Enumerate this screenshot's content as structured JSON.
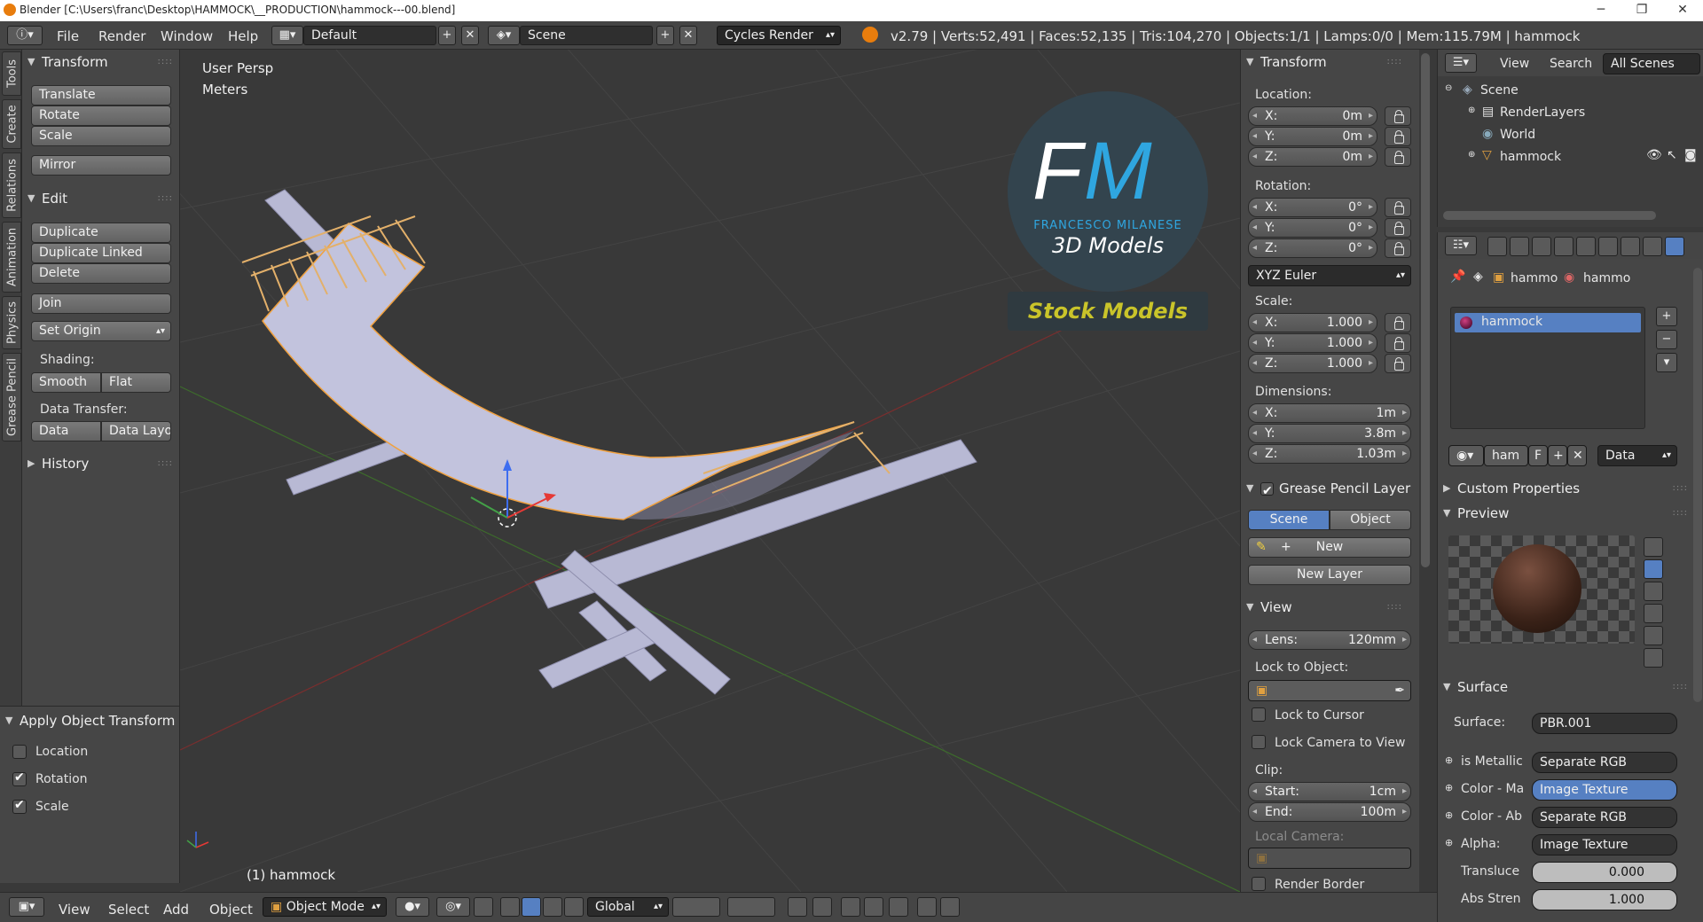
{
  "window": {
    "title": "Blender [C:\\Users\\franc\\Desktop\\HAMMOCK\\__PRODUCTION\\hammock---00.blend]",
    "minimize": "─",
    "maximize": "❐",
    "close": "✕"
  },
  "topbar": {
    "menus": [
      "File",
      "Render",
      "Window",
      "Help"
    ],
    "layout": "Default",
    "scene": "Scene",
    "engine": "Cycles Render",
    "stats": "v2.79 | Verts:52,491 | Faces:52,135 | Tris:104,270 | Objects:1/1 | Lamps:0/0 | Mem:115.79M | hammock"
  },
  "lefttabs": [
    "Tools",
    "Create",
    "Relations",
    "Animation",
    "Physics",
    "Grease Pencil"
  ],
  "toolshelf": {
    "transform": {
      "title": "Transform",
      "buttons": [
        "Translate",
        "Rotate",
        "Scale",
        "Mirror"
      ]
    },
    "edit": {
      "title": "Edit",
      "buttons": [
        "Duplicate",
        "Duplicate Linked",
        "Delete",
        "Join",
        "Set Origin"
      ]
    },
    "shading": {
      "label": "Shading:",
      "smooth": "Smooth",
      "flat": "Flat"
    },
    "datatransfer": {
      "label": "Data Transfer:",
      "data": "Data",
      "datalayo": "Data Layo"
    },
    "history": "History"
  },
  "operator": {
    "title": "Apply Object Transform",
    "options": [
      {
        "label": "Location",
        "checked": false
      },
      {
        "label": "Rotation",
        "checked": true
      },
      {
        "label": "Scale",
        "checked": true
      }
    ]
  },
  "viewport": {
    "view_name": "User Persp",
    "units": "Meters",
    "object_label": "(1) hammock",
    "watermark": {
      "initials_f": "F",
      "initials_m": "M",
      "name": "FRANCESCO MILANESE",
      "sub": "3D Models",
      "badge": "Stock Models"
    }
  },
  "npanel": {
    "transform": "Transform",
    "location_label": "Location:",
    "location": [
      {
        "k": "X:",
        "v": "0m"
      },
      {
        "k": "Y:",
        "v": "0m"
      },
      {
        "k": "Z:",
        "v": "0m"
      }
    ],
    "rotation_label": "Rotation:",
    "rotation": [
      {
        "k": "X:",
        "v": "0°"
      },
      {
        "k": "Y:",
        "v": "0°"
      },
      {
        "k": "Z:",
        "v": "0°"
      }
    ],
    "rotation_mode": "XYZ Euler",
    "scale_label": "Scale:",
    "scale": [
      {
        "k": "X:",
        "v": "1.000"
      },
      {
        "k": "Y:",
        "v": "1.000"
      },
      {
        "k": "Z:",
        "v": "1.000"
      }
    ],
    "dimensions_label": "Dimensions:",
    "dimensions": [
      {
        "k": "X:",
        "v": "1m"
      },
      {
        "k": "Y:",
        "v": "3.8m"
      },
      {
        "k": "Z:",
        "v": "1.03m"
      }
    ],
    "grease": {
      "title": "Grease Pencil Layer",
      "scene": "Scene",
      "object": "Object",
      "new": "New",
      "new_layer": "New Layer"
    },
    "view": {
      "title": "View",
      "lens_k": "Lens:",
      "lens_v": "120mm",
      "lock_obj": "Lock to Object:",
      "lock_cursor": "Lock to Cursor",
      "lock_camera": "Lock Camera to View",
      "clip": "Clip:",
      "start_k": "Start:",
      "start_v": "1cm",
      "end_k": "End:",
      "end_v": "100m",
      "local_camera": "Local Camera:",
      "render_border": "Render Border"
    }
  },
  "outliner": {
    "view": "View",
    "search": "Search",
    "filter": "All Scenes",
    "items": [
      "Scene",
      "RenderLayers",
      "World",
      "hammock"
    ]
  },
  "props": {
    "breadcrumb": [
      "hammo",
      "hammo"
    ],
    "material": "hammock",
    "slot_name": "ham",
    "slot_f": "F",
    "slot_data": "Data",
    "custom_props": "Custom Properties",
    "preview": "Preview",
    "surface": "Surface",
    "rows": [
      {
        "k": "Surface:",
        "v": "PBR.001"
      },
      {
        "k": "is Metallic",
        "v": "Separate RGB"
      },
      {
        "k": "Color - Ma",
        "v": "Image Texture"
      },
      {
        "k": "Color - Ab",
        "v": "Separate RGB"
      },
      {
        "k": "Alpha:",
        "v": "Image Texture"
      },
      {
        "k": "Transluce",
        "v": "0.000"
      },
      {
        "k": "Abs Stren",
        "v": "1.000"
      }
    ]
  },
  "bottombar": {
    "menus": [
      "View",
      "Select",
      "Add",
      "Object"
    ],
    "mode": "Object Mode",
    "orientation": "Global"
  },
  "colors": {
    "accent": "#5680c2",
    "selection": "#f1a13e",
    "fm_blue": "#2fa6e0",
    "badge": "#c9c42a"
  }
}
